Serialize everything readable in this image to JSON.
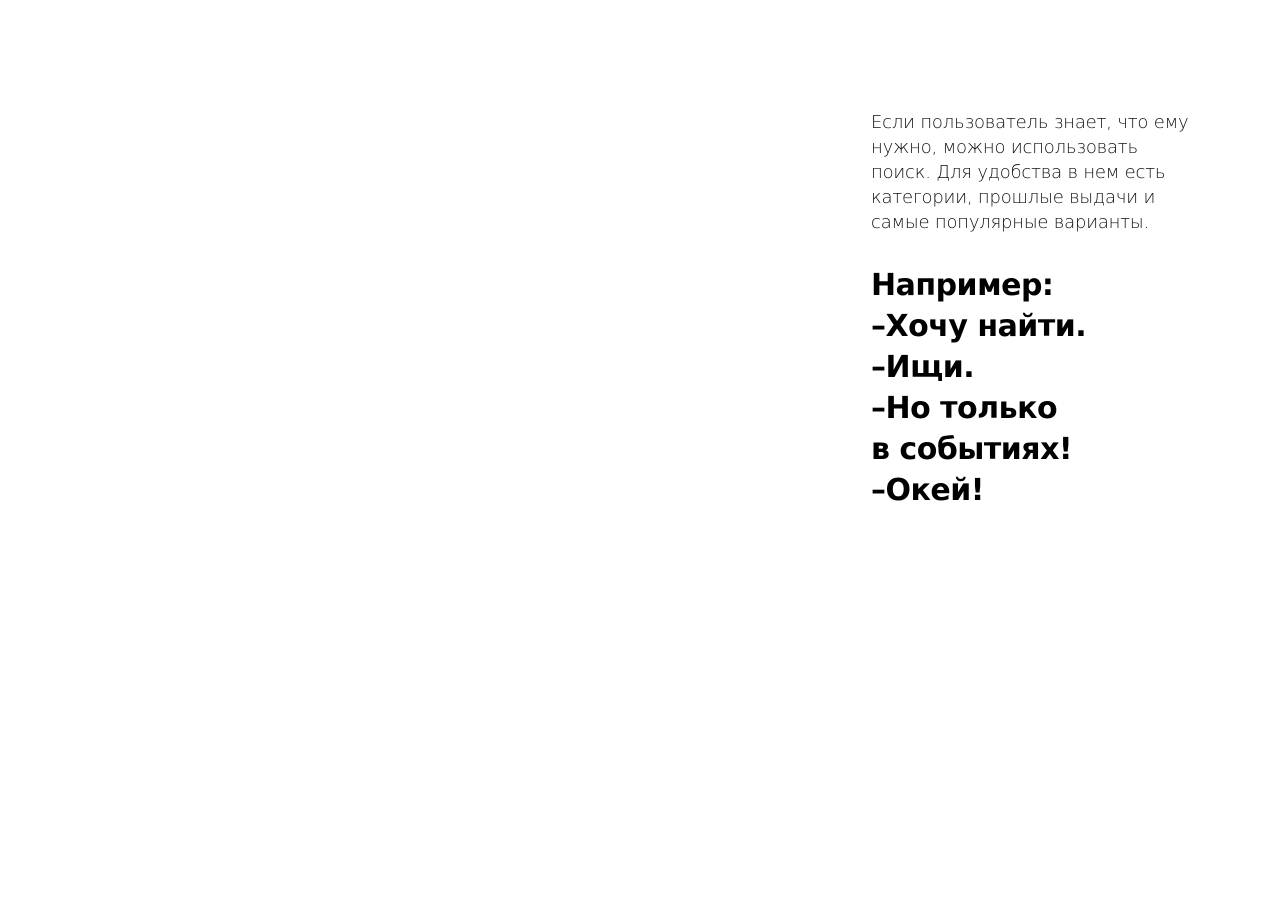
{
  "page": {
    "description_paragraph": "Если пользователь знает, что ему нужно, можно использовать поиск. Для удобства в нем есть категории, прошлые выдачи и самые популярные варианты.",
    "example": {
      "heading": "Например:",
      "lines": [
        "–Хочу найти.",
        "–Ищи.",
        "–Но только",
        "в событиях!",
        "–Окей!"
      ]
    }
  }
}
